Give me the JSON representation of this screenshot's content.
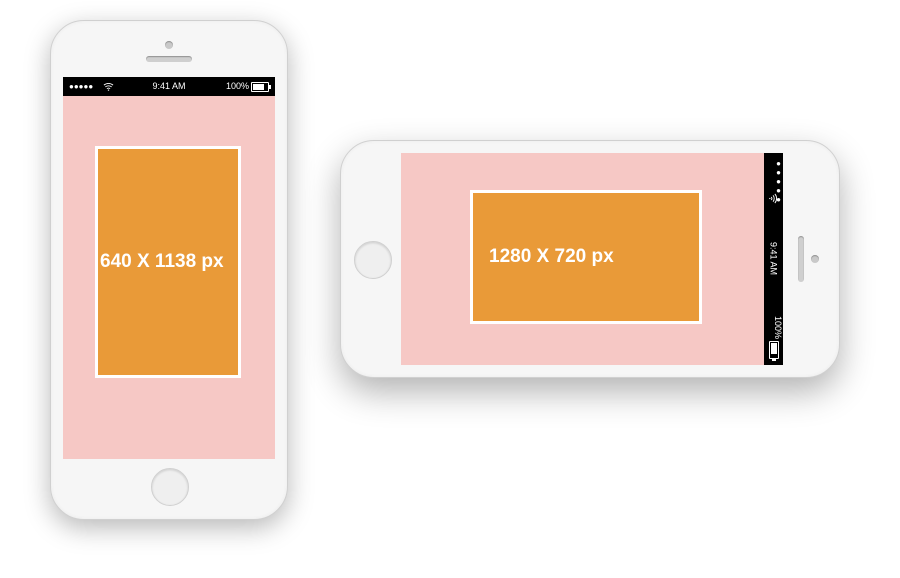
{
  "status": {
    "signal_dots": "●●●●●",
    "time": "9:41 AM",
    "battery_pct": "100%"
  },
  "portrait": {
    "dim_label": "640 X 1138 px"
  },
  "landscape": {
    "dim_label": "1280 X 720 px"
  }
}
